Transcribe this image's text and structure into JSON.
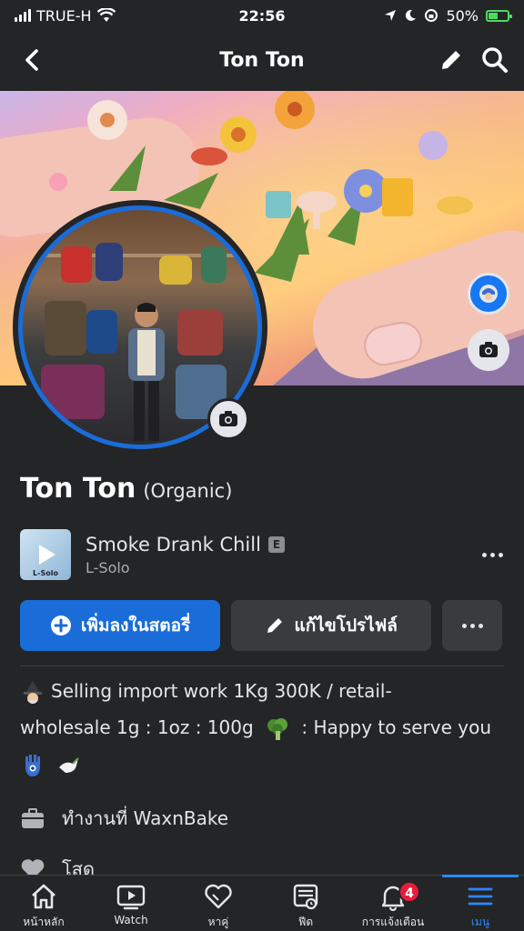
{
  "status_bar": {
    "carrier": "TRUE-H",
    "time": "22:56",
    "battery_percent": "50%",
    "battery_level": 0.5
  },
  "navbar": {
    "title": "Ton Ton"
  },
  "profile": {
    "name": "Ton Ton",
    "alternate_name": "(Organic)"
  },
  "profile_music": {
    "song": "Smoke Drank Chill",
    "explicit_label": "E",
    "artist": "L-Solo",
    "thumb_caption": "L-Solo"
  },
  "actions": {
    "add_story_label": "เพิ่มลงในสตอรี่",
    "edit_profile_label": "แก้ไขโปรไฟล์"
  },
  "bio": {
    "line1": "Selling import work 1Kg 300K / retail-",
    "line2_before": "wholesale 1g : 1oz : 100g",
    "line2_after": ": Happy to serve you"
  },
  "details": [
    {
      "icon": "briefcase-icon",
      "label": "ทำงานที่ WaxnBake"
    },
    {
      "icon": "heart-icon",
      "label": "โสด"
    }
  ],
  "tabbar": {
    "items": [
      {
        "label": "หน้าหลัก",
        "icon": "home-icon"
      },
      {
        "label": "Watch",
        "icon": "watch-icon"
      },
      {
        "label": "หาคู่",
        "icon": "dating-icon"
      },
      {
        "label": "ฟีด",
        "icon": "feed-icon"
      },
      {
        "label": "การแจ้งเตือน",
        "icon": "bell-icon",
        "badge": "4"
      },
      {
        "label": "เมนู",
        "icon": "menu-icon",
        "active": true
      }
    ]
  },
  "colors": {
    "background": "#242526",
    "accent": "#1a6dd8",
    "secondary_button": "#3a3b3c",
    "badge": "#e41e3f"
  }
}
